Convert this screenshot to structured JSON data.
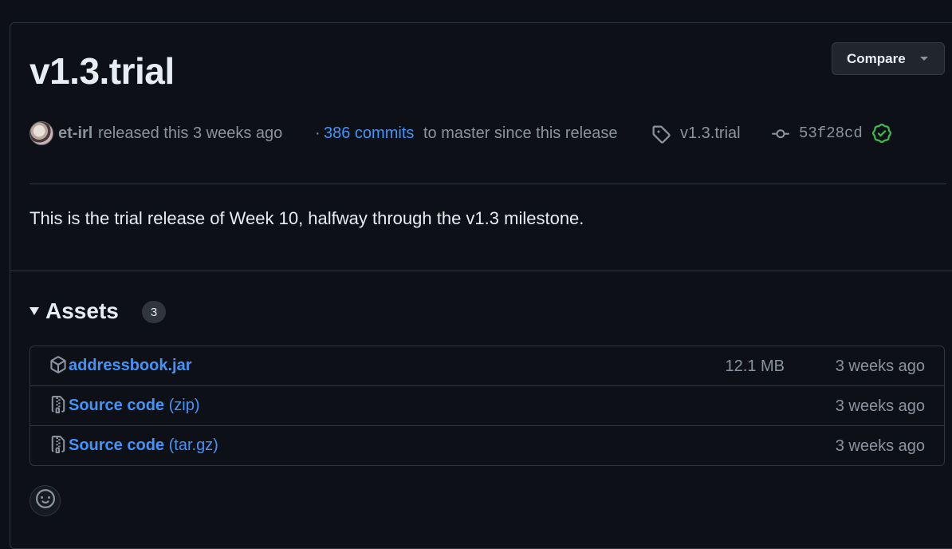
{
  "release": {
    "title": "v1.3.trial",
    "compare_label": "Compare",
    "author": "et-irl",
    "released_text": "released this 3 weeks ago",
    "commits_sep": "·",
    "commits_link": "386 commits",
    "commits_rest": "to master since this release",
    "tag": "v1.3.trial",
    "commit_sha": "53f28cd",
    "description": "This is the trial release of Week 10, halfway through the v1.3 milestone."
  },
  "assets": {
    "title": "Assets",
    "count": "3",
    "items": [
      {
        "name": "addressbook.jar",
        "ext": "",
        "size": "12.1 MB",
        "date": "3 weeks ago",
        "icon": "package-icon"
      },
      {
        "name": "Source code",
        "ext": "(zip)",
        "size": "",
        "date": "3 weeks ago",
        "icon": "file-zip-icon"
      },
      {
        "name": "Source code",
        "ext": "(tar.gz)",
        "size": "",
        "date": "3 weeks ago",
        "icon": "file-zip-icon"
      }
    ]
  },
  "colors": {
    "background": "#0d1117",
    "border": "#30363d",
    "link": "#4493f8",
    "muted": "#8b949e",
    "verified": "#3fb950"
  }
}
